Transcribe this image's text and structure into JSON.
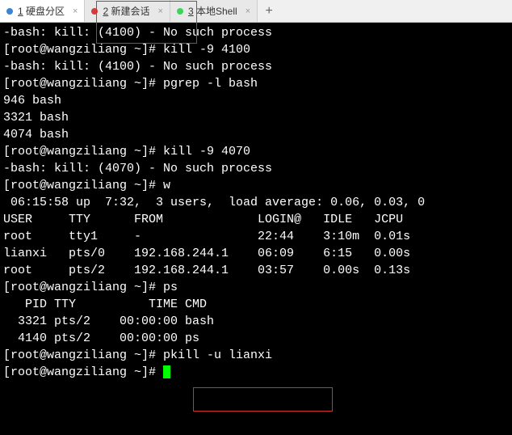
{
  "tabs": [
    {
      "num": "1",
      "label": "硬盘分区",
      "dotClass": "dot-blue"
    },
    {
      "num": "2",
      "label": "新建会话",
      "dotClass": "dot-red"
    },
    {
      "num": "3",
      "label": "本地Shell",
      "dotClass": "dot-green"
    }
  ],
  "terminal": {
    "l0": "-bash: kill: (4100) - No such process",
    "l1": "[root@wangziliang ~]# kill -9 4100",
    "l2": "-bash: kill: (4100) - No such process",
    "l3": "[root@wangziliang ~]# pgrep -l bash",
    "l4": "946 bash",
    "l5": "3321 bash",
    "l6": "4074 bash",
    "l7": "[root@wangziliang ~]# kill -9 4070",
    "l8": "-bash: kill: (4070) - No such process",
    "l9": "[root@wangziliang ~]# w",
    "l10": " 06:15:58 up  7:32,  3 users,  load average: 0.06, 0.03, 0",
    "l11": "USER     TTY      FROM             LOGIN@   IDLE   JCPU",
    "l12": "root     tty1     -                22:44    3:10m  0.01s",
    "l13": "lianxi   pts/0    192.168.244.1    06:09    6:15   0.00s",
    "l14": "root     pts/2    192.168.244.1    03:57    0.00s  0.13s",
    "l15": "[root@wangziliang ~]# ps",
    "l16": "   PID TTY          TIME CMD",
    "l17": "  3321 pts/2    00:00:00 bash",
    "l18": "  4140 pts/2    00:00:00 ps",
    "l19": "[root@wangziliang ~]# pkill -u lianxi",
    "l20": "[root@wangziliang ~]# "
  },
  "w_output": {
    "time": "06:15:58",
    "up": "7:32",
    "users": 3,
    "load_avg": [
      0.06,
      0.03,
      0
    ],
    "sessions": [
      {
        "user": "root",
        "tty": "tty1",
        "from": "-",
        "login": "22:44",
        "idle": "3:10m",
        "jcpu": "0.01s"
      },
      {
        "user": "lianxi",
        "tty": "pts/0",
        "from": "192.168.244.1",
        "login": "06:09",
        "idle": "6:15",
        "jcpu": "0.00s"
      },
      {
        "user": "root",
        "tty": "pts/2",
        "from": "192.168.244.1",
        "login": "03:57",
        "idle": "0.00s",
        "jcpu": "0.13s"
      }
    ]
  },
  "ps_output": [
    {
      "pid": 3321,
      "tty": "pts/2",
      "time": "00:00:00",
      "cmd": "bash"
    },
    {
      "pid": 4140,
      "tty": "pts/2",
      "time": "00:00:00",
      "cmd": "ps"
    }
  ],
  "pgrep_output": [
    {
      "pid": 946,
      "name": "bash"
    },
    {
      "pid": 3321,
      "name": "bash"
    },
    {
      "pid": 4074,
      "name": "bash"
    }
  ]
}
